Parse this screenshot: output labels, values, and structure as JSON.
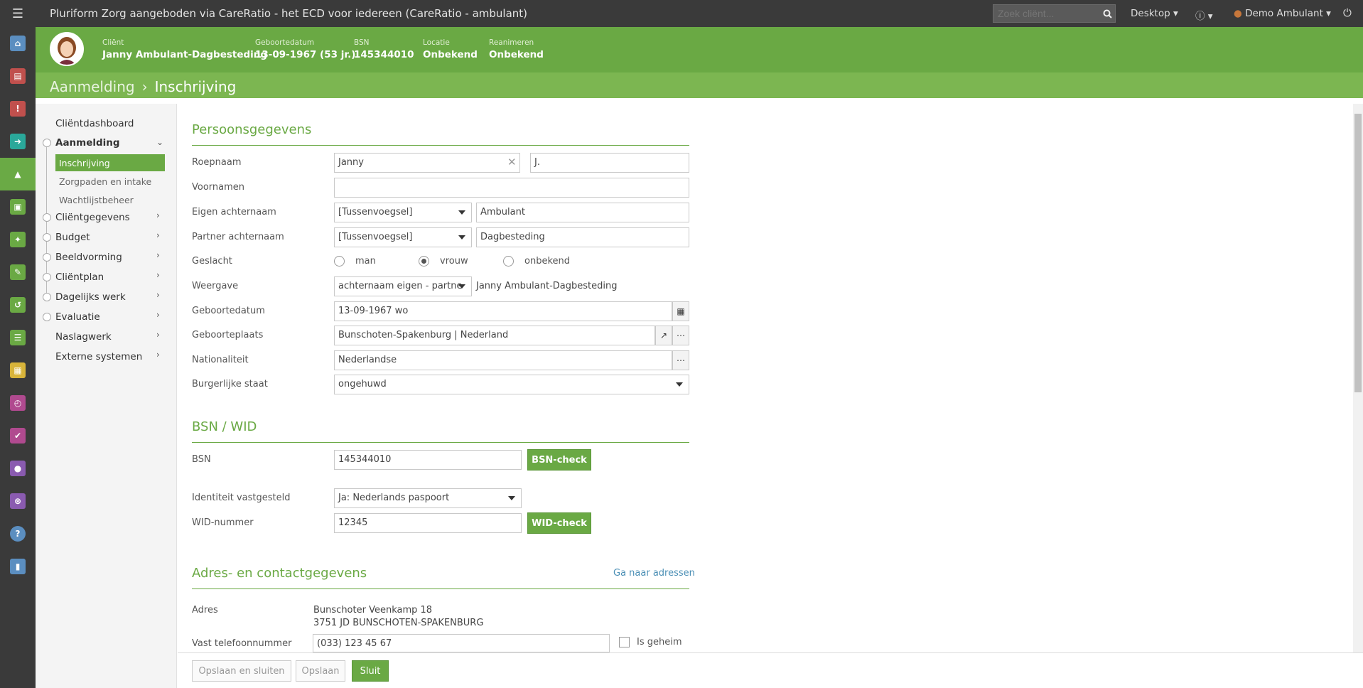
{
  "topbar": {
    "title": "Pluriform Zorg aangeboden via CareRatio - het ECD voor iedereen  (CareRatio - ambulant)",
    "search_placeholder": "Zoek cliënt...",
    "desktop": "Desktop",
    "user": "Demo Ambulant"
  },
  "colors": {
    "green": "#6aa944",
    "dark": "#3a3a3a"
  },
  "client": {
    "client_label": "Cliënt",
    "client_name": "Janny Ambulant-Dagbesteding",
    "dob_label": "Geboortedatum",
    "dob": "13-09-1967 (53 jr.)",
    "bsn_label": "BSN",
    "bsn": "145344010",
    "loc_label": "Locatie",
    "loc": "Onbekend",
    "rean_label": "Reanimeren",
    "rean": "Onbekend"
  },
  "breadcrumb": {
    "parent": "Aanmelding",
    "current": "Inschrijving"
  },
  "nav": {
    "dashboard": "Cliëntdashboard",
    "aanmelding": "Aanmelding",
    "sub": [
      "Inschrijving",
      "Zorgpaden en intake",
      "Wachtlijstbeheer"
    ],
    "clientgegevens": "Cliëntgegevens",
    "budget": "Budget",
    "beeldvorming": "Beeldvorming",
    "clientplan": "Cliëntplan",
    "dagelijks": "Dagelijks werk",
    "evaluatie": "Evaluatie",
    "naslagwerk": "Naslagwerk",
    "extern": "Externe systemen"
  },
  "persons": {
    "title": "Persoonsgegevens",
    "roepnaam_label": "Roepnaam",
    "roepnaam": "Janny",
    "initials": "J.",
    "voornamen_label": "Voornamen",
    "voornamen": "",
    "eigen_label": "Eigen achternaam",
    "eigen_tv": "[Tussenvoegsel]",
    "eigen": "Ambulant",
    "partner_label": "Partner achternaam",
    "partner_tv": "[Tussenvoegsel]",
    "partner": "Dagbesteding",
    "geslacht_label": "Geslacht",
    "gender_options": [
      "man",
      "vrouw",
      "onbekend"
    ],
    "weergave_label": "Weergave",
    "weergave": "achternaam eigen - partne",
    "weergave_preview": "Janny Ambulant-Dagbesteding",
    "geboortedatum_label": "Geboortedatum",
    "geboortedatum": "13-09-1967 wo",
    "geboorteplaats_label": "Geboorteplaats",
    "geboorteplaats": "Bunschoten-Spakenburg | Nederland",
    "nationaliteit_label": "Nationaliteit",
    "nationaliteit": "Nederlandse",
    "burgerlijk_label": "Burgerlijke staat",
    "burgerlijk": "ongehuwd"
  },
  "bsn": {
    "title": "BSN / WID",
    "bsn_label": "BSN",
    "bsn": "145344010",
    "bsn_check": "BSN-check",
    "identiteit_label": "Identiteit vastgesteld",
    "identiteit": "Ja: Nederlands paspoort",
    "wid_label": "WID-nummer",
    "wid": "12345",
    "wid_check": "WID-check"
  },
  "adres": {
    "title": "Adres- en contactgegevens",
    "link": "Ga naar adressen",
    "adres_label": "Adres",
    "line1": "Bunschoter Veenkamp 18",
    "line2": "3751 JD BUNSCHOTEN-SPAKENBURG",
    "tel_label": "Vast telefoonnummer",
    "tel": "(033) 123 45 67",
    "geheim": "Is geheim"
  },
  "footer": {
    "save_close": "Opslaan en sluiten",
    "save": "Opslaan",
    "close": "Sluit"
  }
}
